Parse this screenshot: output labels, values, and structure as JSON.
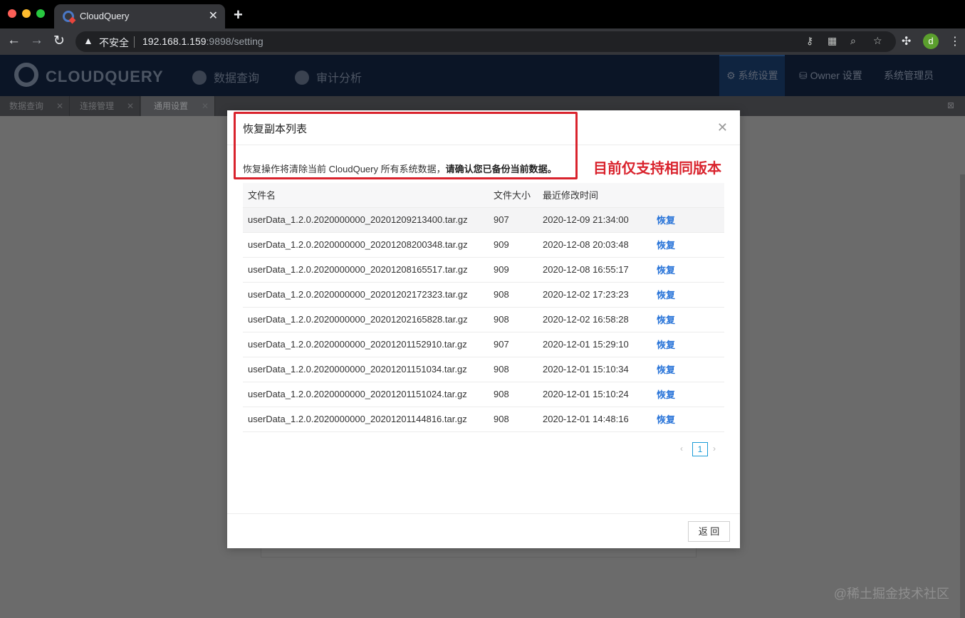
{
  "browser": {
    "tab_title": "CloudQuery",
    "tab_close": "✕",
    "new_tab": "+",
    "insecure_label": "不安全",
    "url_host": "192.168.1.159",
    "url_rest": ":9898/setting",
    "profile_initial": "d"
  },
  "app": {
    "logo_text": "CLOUDQUERY",
    "nav": {
      "data_query": "数据查询",
      "audit": "审计分析",
      "system_settings": "系统设置",
      "owner_settings": "Owner 设置",
      "admin": "系统管理员"
    },
    "subtabs": [
      {
        "label": "数据查询"
      },
      {
        "label": "连接管理"
      },
      {
        "label": "通用设置"
      }
    ]
  },
  "modal": {
    "title": "恢复副本列表",
    "warning_prefix": "恢复操作将清除当前 CloudQuery 所有系统数据，",
    "warning_bold": "请确认您已备份当前数据。",
    "annotation": "目前仅支持相同版本",
    "columns": {
      "name": "文件名",
      "size": "文件大小",
      "modified": "最近修改时间"
    },
    "action_label": "恢复",
    "rows": [
      {
        "name": "userData_1.2.0.2020000000_20201209213400.tar.gz",
        "size": "907",
        "modified": "2020-12-09 21:34:00"
      },
      {
        "name": "userData_1.2.0.2020000000_20201208200348.tar.gz",
        "size": "909",
        "modified": "2020-12-08 20:03:48"
      },
      {
        "name": "userData_1.2.0.2020000000_20201208165517.tar.gz",
        "size": "909",
        "modified": "2020-12-08 16:55:17"
      },
      {
        "name": "userData_1.2.0.2020000000_20201202172323.tar.gz",
        "size": "908",
        "modified": "2020-12-02 17:23:23"
      },
      {
        "name": "userData_1.2.0.2020000000_20201202165828.tar.gz",
        "size": "908",
        "modified": "2020-12-02 16:58:28"
      },
      {
        "name": "userData_1.2.0.2020000000_20201201152910.tar.gz",
        "size": "907",
        "modified": "2020-12-01 15:29:10"
      },
      {
        "name": "userData_1.2.0.2020000000_20201201151034.tar.gz",
        "size": "908",
        "modified": "2020-12-01 15:10:34"
      },
      {
        "name": "userData_1.2.0.2020000000_20201201151024.tar.gz",
        "size": "908",
        "modified": "2020-12-01 15:10:24"
      },
      {
        "name": "userData_1.2.0.2020000000_20201201144816.tar.gz",
        "size": "908",
        "modified": "2020-12-01 14:48:16"
      }
    ],
    "pagination": {
      "current_page": "1"
    },
    "back_button": "返 回"
  },
  "watermark": "@稀土掘金技术社区",
  "colors": {
    "annotation_red": "#d9232d",
    "link_blue": "#2773d8",
    "page_active": "#1a9bd7"
  }
}
